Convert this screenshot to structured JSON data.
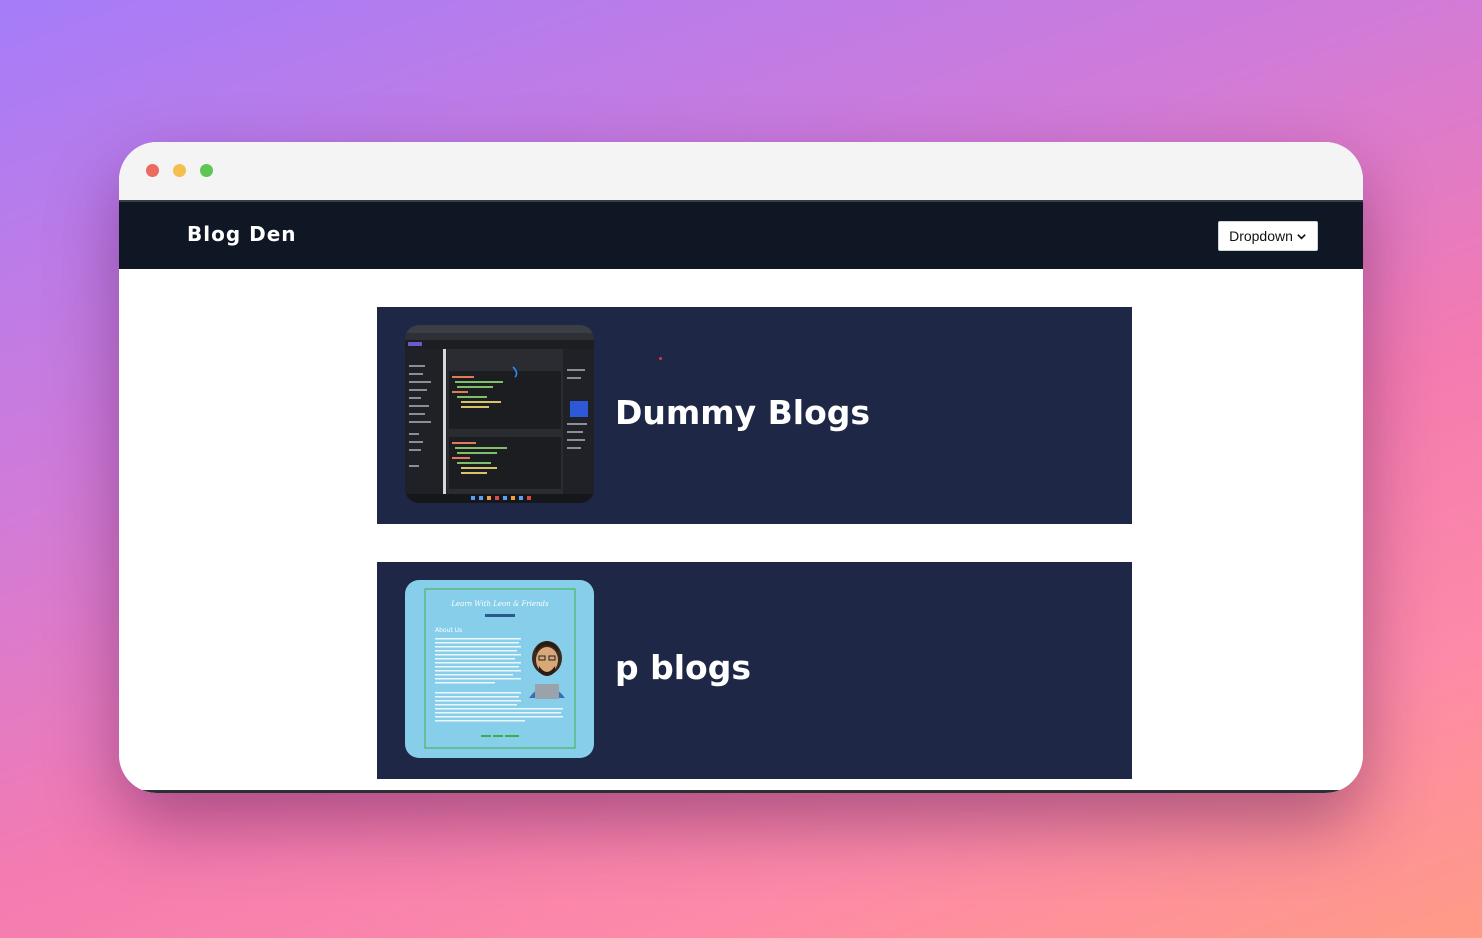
{
  "navbar": {
    "brand": "Blog Den",
    "dropdown_label": "Dropdown"
  },
  "blogs": [
    {
      "title": "Dummy Blogs",
      "thumbnail": "code-editor-screenshot"
    },
    {
      "title": "p blogs",
      "thumbnail": "about-us-page-screenshot",
      "thumb_heading": "Learn With Leon & Friends",
      "thumb_section": "About Us"
    }
  ],
  "colors": {
    "navbar_bg": "#0f1624",
    "card_bg": "#1e2746",
    "thumb2_bg": "#87ceeb"
  }
}
